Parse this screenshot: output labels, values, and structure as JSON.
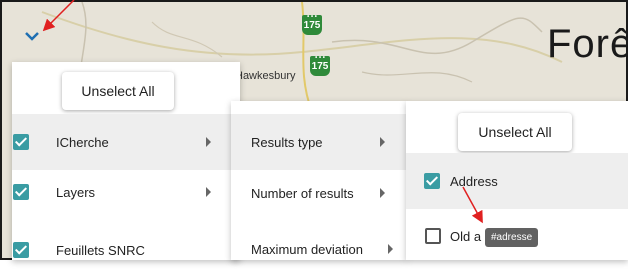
{
  "map": {
    "title": "Forê",
    "town_label": "Hawkesbury",
    "highway_1": "175",
    "highway_2": "175"
  },
  "toggle": {
    "icon": "chevron-down-icon"
  },
  "menu1": {
    "unselect_label": "Unselect All",
    "items": [
      {
        "label": "ICherche",
        "checked": true
      },
      {
        "label": "Layers",
        "checked": true
      },
      {
        "label": "Feuillets SNRC",
        "checked": true
      }
    ]
  },
  "menu2": {
    "items": [
      {
        "label": "Results type"
      },
      {
        "label": "Number of results"
      },
      {
        "label": "Maximum deviation"
      }
    ]
  },
  "menu3": {
    "unselect_label": "Unselect All",
    "items": [
      {
        "label": "Address",
        "checked": true
      },
      {
        "label": "Old a",
        "checked": false
      }
    ]
  },
  "tooltip": {
    "text": "#adresse"
  },
  "colors": {
    "accent": "#1f6fb2",
    "checkbox": "#3a9ca3",
    "annotation": "#e02020"
  }
}
